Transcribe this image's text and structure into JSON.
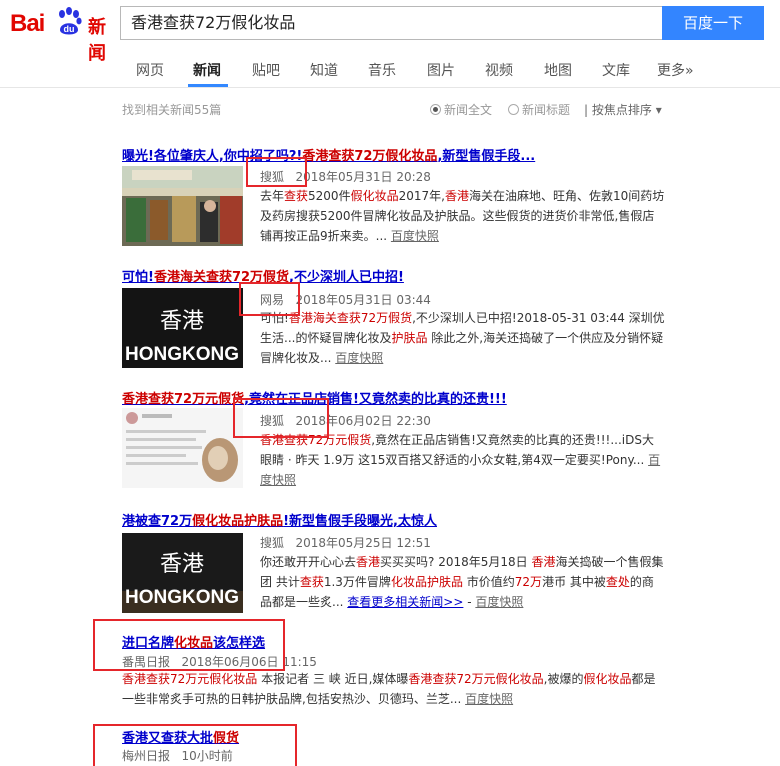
{
  "logo": {
    "text_bai": "Bai",
    "text_du": "du",
    "text_news": "新闻"
  },
  "search": {
    "query": "香港查获72万假化妆品",
    "button_label": "百度一下"
  },
  "tabs": [
    {
      "label": "网页"
    },
    {
      "label": "新闻",
      "active": true
    },
    {
      "label": "贴吧"
    },
    {
      "label": "知道"
    },
    {
      "label": "音乐"
    },
    {
      "label": "图片"
    },
    {
      "label": "视频"
    },
    {
      "label": "地图"
    },
    {
      "label": "文库"
    },
    {
      "label": "更多»"
    }
  ],
  "meta": {
    "count_text": "找到相关新闻55篇",
    "option_fulltext": "新闻全文",
    "option_title": "新闻标题",
    "sort_label": "按焦点排序"
  },
  "results": [
    {
      "title_a": "曝光!各位肇庆人,你中招了吗?!",
      "title_b": "香港查获72万假化妆品",
      "title_c": ",新型售假手段...",
      "source": "搜狐",
      "time": "2018年05月31日 20:28",
      "summary": [
        "去年",
        "查获",
        "5200件",
        "假化妆品",
        "2017年,",
        "香港",
        "海关在油麻地、旺角、佐敦10间药坊及药房搜获5200件冒牌化妆品及护肤品。这些假货的进货价非常低,售假店铺再按正品9折来卖。... "
      ],
      "snapshot": "百度快照"
    },
    {
      "title_a": "可怕!",
      "title_b": "香港海关查获72万假货",
      "title_c": ",不少深圳人已中招!",
      "source": "网易",
      "time": "2018年05月31日 03:44",
      "summary": [
        "可怕!",
        "香港海关查获72万假货",
        ",不少深圳人已中招!2018-05-31 03:44 深圳优生活...的怀疑冒牌化妆及",
        "护肤品",
        " 除此之外,海关还捣破了一个供应及分销怀疑冒牌化妆及... "
      ],
      "snapshot": "百度快照"
    },
    {
      "title_a": "",
      "title_b": "香港查获72万元假货",
      "title_c": ",竟然在正品店销售!又竟然卖的比真的还贵!!!",
      "source": "搜狐",
      "time": "2018年06月02日 22:30",
      "summary": [
        "",
        "香港查获72万元假货",
        ",竟然在正品店销售!又竟然卖的比真的还贵!!!...iDS大眼睛 · 昨天 1.9万 这15双百搭又舒适的小众女鞋,第4双一定要买!Pony... "
      ],
      "snapshot": "百度快照"
    },
    {
      "title_a": "港被查72万",
      "title_b": "假化妆品护肤品",
      "title_c": "!新型售假手段曝光,太惊人",
      "source": "搜狐",
      "time": "2018年05月25日 12:51",
      "summary": [
        "你还敢开开心心去",
        "香港",
        "买买买吗? 2018年5月18日 ",
        "香港",
        "海关捣破一个售假集团 共计",
        "查获",
        "1.3万件冒牌",
        "化妆品护肤品",
        " 市价值约",
        "72万",
        "港币 其中被",
        "查处",
        "的商品都是一些炙... "
      ],
      "more": "查看更多相关新闻>>",
      "snapshot": "百度快照"
    },
    {
      "title_a": "进口名牌",
      "title_b": "化妆品",
      "title_c": "该怎样选",
      "source": "番禺日报",
      "time": "2018年06月06日 11:15",
      "summary": [
        "",
        "香港查获",
        "72万元",
        "假化妆品",
        " 本报记者 三 峡 近日,媒体曝",
        "香港查获72万元假化妆品",
        ",被爆的",
        "假化妆品",
        "都是一些非常炙手可热的日韩护肤品牌,包括安热沙、贝德玛、兰芝... "
      ],
      "snapshot": "百度快照"
    },
    {
      "title_a": "香港又查获大批",
      "title_b": "假货",
      "title_c": "",
      "source": "梅州日报",
      "time": "10小时前"
    }
  ],
  "thumb_text": {
    "hongkong_cn": "香港",
    "hongkong_en": "HONGKONG"
  },
  "colors": {
    "brand_red": "#e10601",
    "link_blue": "#0000cc",
    "highlight_red": "#cc0000",
    "button_blue": "#3385ff",
    "annotation_red": "#e5262b"
  }
}
